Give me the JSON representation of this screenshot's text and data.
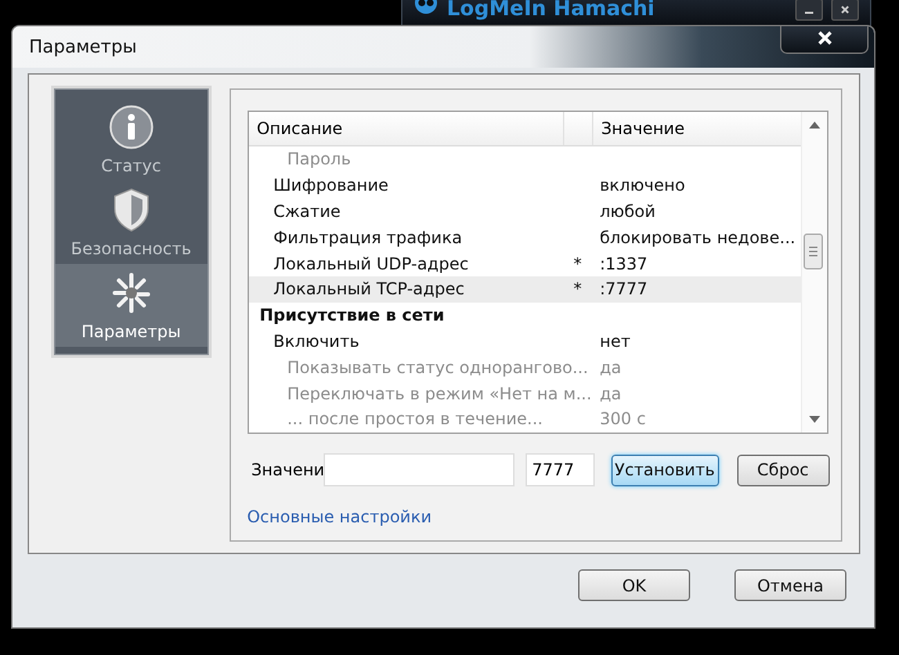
{
  "background_window": {
    "title": "LogMeIn Hamachi"
  },
  "window": {
    "title": "Параметры"
  },
  "sidebar": {
    "items": [
      {
        "label": "Статус",
        "selected": false
      },
      {
        "label": "Безопасность",
        "selected": false
      },
      {
        "label": "Параметры",
        "selected": true
      }
    ]
  },
  "list": {
    "columns": [
      "Описание",
      "Значение"
    ],
    "rows": [
      {
        "kind": "item",
        "label": "Пароль",
        "disabled": true,
        "selected": false
      },
      {
        "kind": "item",
        "label": "Шифрование",
        "value": "включено",
        "disabled": false,
        "selected": false
      },
      {
        "kind": "item",
        "label": "Сжатие",
        "value": "любой",
        "disabled": false,
        "selected": false
      },
      {
        "kind": "item",
        "label": "Фильтрация трафика",
        "value": "блокировать недове...",
        "disabled": false,
        "selected": false
      },
      {
        "kind": "item",
        "label": "Локальный UDP-адрес",
        "marker": "*",
        "value": ":1337",
        "disabled": false,
        "selected": false
      },
      {
        "kind": "item",
        "label": "Локальный TCP-адрес",
        "marker": "*",
        "value": ":7777",
        "disabled": false,
        "selected": true
      },
      {
        "kind": "section",
        "label": "Присутствие в сети",
        "selected": false,
        "children": [
          {
            "kind": "item",
            "label": "Включить",
            "value": "нет",
            "disabled": false,
            "selected": false,
            "children": [
              {
                "kind": "item",
                "label": "Показывать статус однорангово...",
                "value": "да",
                "disabled": true,
                "selected": false
              },
              {
                "kind": "item",
                "label": "Переключать в режим «Нет на м...",
                "value": "да",
                "disabled": true,
                "selected": false
              },
              {
                "kind": "item",
                "label": "... после простоя в течение...",
                "value": "300 с",
                "disabled": true,
                "selected": false
              }
            ]
          }
        ]
      }
    ]
  },
  "editor": {
    "label": "Значени",
    "field_2": {
      "value": "7777"
    },
    "set_button": "Установить",
    "reset_button": "Сброс"
  },
  "link": "Основные настройки",
  "buttons": [
    {
      "label": "OK"
    },
    {
      "label": "Отмена"
    }
  ]
}
